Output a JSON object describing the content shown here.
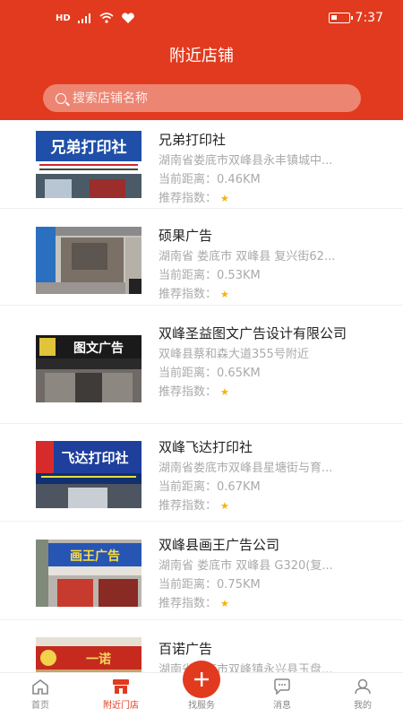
{
  "status": {
    "left": "HD",
    "time": "7:37"
  },
  "header": {
    "title": "附近店铺"
  },
  "search": {
    "placeholder": "搜索店铺名称"
  },
  "labels": {
    "distance": "当前距离：",
    "rating": "推荐指数："
  },
  "stores": [
    {
      "name": "兄弟打印社",
      "address": "湖南省娄底市双峰县永丰镇城中...",
      "distance": "0.46KM",
      "stars": 1,
      "photo_sign": "兄弟打印社"
    },
    {
      "name": "硕果广告",
      "address": "湖南省 娄底市 双峰县 复兴街62...",
      "distance": "0.53KM",
      "stars": 1,
      "photo_sign": ""
    },
    {
      "name": "双峰圣益图文广告设计有限公司",
      "address": "双峰县蔡和森大道355号附近",
      "distance": "0.65KM",
      "stars": 1,
      "photo_sign": "图文广告"
    },
    {
      "name": "双峰飞达打印社",
      "address": "湖南省娄底市双峰县星塘街与育...",
      "distance": "0.67KM",
      "stars": 1,
      "photo_sign": "飞达打印社"
    },
    {
      "name": "双峰县画王广告公司",
      "address": "湖南省 娄底市 双峰县 G320(复...",
      "distance": "0.75KM",
      "stars": 1,
      "photo_sign": "画王广告"
    },
    {
      "name": "百诺广告",
      "address": "湖南省娄底市双峰镇永兴县玉盘...",
      "distance": "",
      "stars": 0,
      "photo_sign": "一诺"
    }
  ],
  "nav": {
    "home": "首页",
    "nearby": "附近门店",
    "service": "找服务",
    "messages": "消息",
    "mine": "我的"
  },
  "colors": {
    "brand": "#e23a1e",
    "star": "#f5b400"
  }
}
